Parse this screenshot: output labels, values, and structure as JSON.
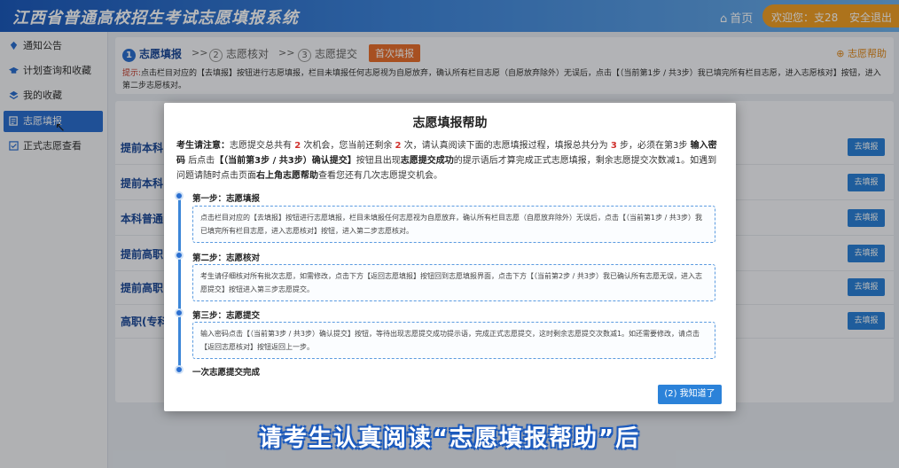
{
  "header": {
    "title": "江西省普通高校招生考试志愿填报系统",
    "home_label": "首页",
    "welcome_text": "欢迎您：支28",
    "logout_label": "安全退出"
  },
  "sidebar": {
    "items": [
      {
        "label": "通知公告",
        "icon": "notice-icon"
      },
      {
        "label": "计划查询和收藏",
        "icon": "graduation-cap-icon"
      },
      {
        "label": "我的收藏",
        "icon": "layers-icon"
      },
      {
        "label": "志愿填报",
        "icon": "edit-icon",
        "active": true
      },
      {
        "label": "正式志愿查看",
        "icon": "check-square-icon"
      }
    ]
  },
  "steps": {
    "items": [
      {
        "num": "1",
        "label": "志愿填报",
        "active": true
      },
      {
        "num": "2",
        "label": "志愿核对"
      },
      {
        "num": "3",
        "label": "志愿提交"
      }
    ],
    "separator": ">>",
    "first_badge": "首次填报",
    "help_link": "志愿帮助"
  },
  "hint": {
    "label": "提示:",
    "text": "点击栏目对应的【去填报】按钮进行志愿填报，栏目未填报任何志愿视为自愿放弃，确认所有栏目志愿（自愿放弃除外）无误后，点击【（当前第1步 / 共3步）我已填完所有栏目志愿，进入志愿核对】按钮，进入第二步志愿核对。"
  },
  "categories": [
    {
      "name": "提前本科",
      "button": "去填报"
    },
    {
      "name": "提前本科",
      "button": "去填报"
    },
    {
      "name": "本科普通",
      "button": "去填报"
    },
    {
      "name": "提前高职",
      "button": "去填报"
    },
    {
      "name": "提前高职",
      "button": "去填报"
    },
    {
      "name": "高职(专科",
      "button": "去填报"
    }
  ],
  "modal": {
    "title": "志愿填报帮助",
    "notice": {
      "lead": "考生请注意：",
      "p1": "志愿提交总共有",
      "total": "2",
      "p2": "次机会，您当前还剩余",
      "remain": "2",
      "p3": "次，请认真阅读下面的志愿填报过程，填报总共分为",
      "step_count": "3",
      "p4": "步，必须在第3步",
      "input_pw": "输入密码",
      "p5": "后点击",
      "confirm_btn": "【（当前第3步 / 共3步）确认提交】",
      "p6": "按钮且出现",
      "success": "志愿提交成功",
      "p7": "的提示语后才算完成正式志愿填报，剩余志愿提交次数减1。如遇到问题请随时点击页面",
      "help_pos": "右上角志愿帮助",
      "p8": "查看您还有几次志愿提交机会。"
    },
    "steps": [
      {
        "title": "第一步：志愿填报",
        "text": "点击栏目对应的【去填报】按钮进行志愿填报，栏目未填报任何志愿视为自愿放弃，确认所有栏目志愿（自愿放弃除外）无误后，点击【（当前第1步 / 共3步）我已填完所有栏目志愿，进入志愿核对】按钮，进入第二步志愿核对。"
      },
      {
        "title": "第二步：志愿核对",
        "text": "考生请仔细核对所有批次志愿，如需修改，点击下方【返回志愿填报】按钮回到志愿填报界面，点击下方【（当前第2步 / 共3步）我已确认所有志愿无误，进入志愿提交】按钮进入第三步志愿提交。"
      },
      {
        "title": "第三步：志愿提交",
        "text": "输入密码点击【（当前第3步 / 共3步）确认提交】按钮，等待出现志愿提交成功提示语，完成正式志愿提交，这时剩余志愿提交次数减1。如还需要修改，请点击【返回志愿核对】按钮返回上一步。"
      }
    ],
    "final_step": "一次志愿提交完成",
    "ok_button": "(2) 我知道了"
  },
  "caption": "请考生认真阅读“志愿填报帮助”后",
  "colors": {
    "primary": "#2b6fd0",
    "accent": "#f0a028",
    "badge": "#e86f2e",
    "warning_red": "#d0312d"
  }
}
